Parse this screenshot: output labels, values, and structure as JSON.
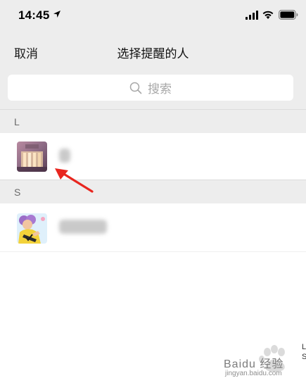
{
  "status": {
    "time": "14:45"
  },
  "nav": {
    "cancel_label": "取消",
    "title": "选择提醒的人"
  },
  "search": {
    "placeholder": "搜索"
  },
  "sections": [
    {
      "letter": "L",
      "contacts": [
        {
          "name": ""
        }
      ]
    },
    {
      "letter": "S",
      "contacts": [
        {
          "name": ""
        }
      ]
    }
  ],
  "index_bar": {
    "letters": [
      "L",
      "S"
    ]
  },
  "watermark": {
    "text": "Baidu 经验",
    "url": "jingyan.baidu.com"
  },
  "colors": {
    "header_bg": "#ededed",
    "annotation_arrow": "#e8261f",
    "text": "#111111"
  }
}
